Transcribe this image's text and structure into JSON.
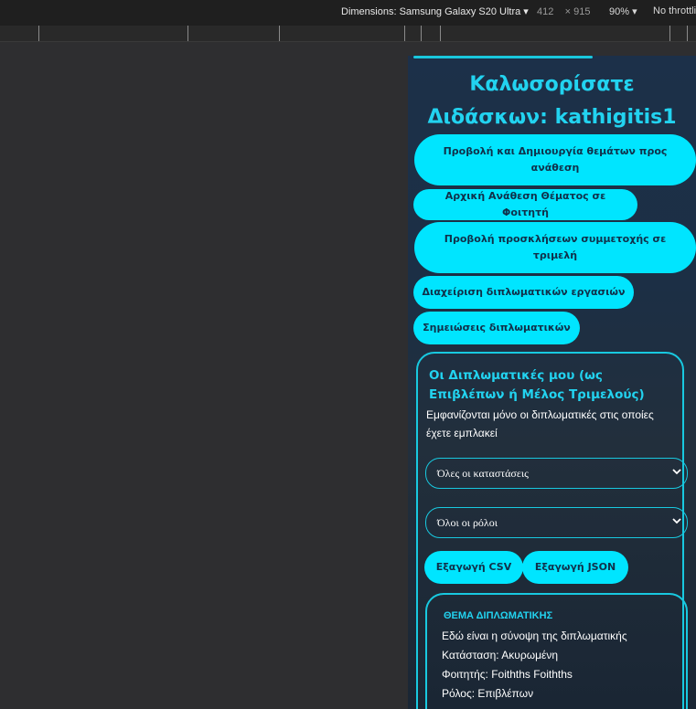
{
  "devtools": {
    "dimensions_label": "Dimensions: Samsung Galaxy S20 Ultra ▾",
    "width": "412",
    "times": "×",
    "height": "915",
    "zoom": "90% ▾",
    "throttling": "No throttli"
  },
  "page": {
    "welcome_line1": "Καλωσορίσατε",
    "welcome_line2": "Διδάσκων: kathigitis1",
    "nav": [
      {
        "label": "Προβολή και Δημιουργία θεμάτων προς ανάθεση"
      },
      {
        "label": "Αρχική Ανάθεση Θέματος σε Φοιτητή"
      },
      {
        "label": "Προβολή προσκλήσεων συμμετοχής σε τριμελή"
      },
      {
        "label": "Διαχείριση διπλωματικών εργασιών"
      },
      {
        "label": "Σημειώσεις διπλωματικών"
      }
    ],
    "card": {
      "title": "Οι Διπλωματικές μου (ως Επιβλέπων ή Μέλος Τριμελούς)",
      "description": "Εμφανίζονται μόνο οι διπλωματικές στις οποίες έχετε εμπλακεί",
      "status_filter": "Όλες οι καταστάσεις",
      "role_filter": "Όλοι οι ρόλοι",
      "export_csv": "Εξαγωγή CSV",
      "export_json": "Εξαγωγή JSON",
      "thesis": {
        "heading": "ΘΕΜΑ ΔΙΠΛΩΜΑΤΙΚΗΣ",
        "summary": "Εδώ είναι η σύνοψη της διπλωματικής",
        "status": "Κατάσταση: Ακυρωμένη",
        "student": "Φοιτητής: Foithths Foithths",
        "role": "Ρόλος: Επιβλέπων"
      }
    }
  },
  "colors": {
    "accent": "#00e5ff",
    "heading": "#22d3f0",
    "border": "#18c9e0",
    "background": "#1c3049"
  }
}
